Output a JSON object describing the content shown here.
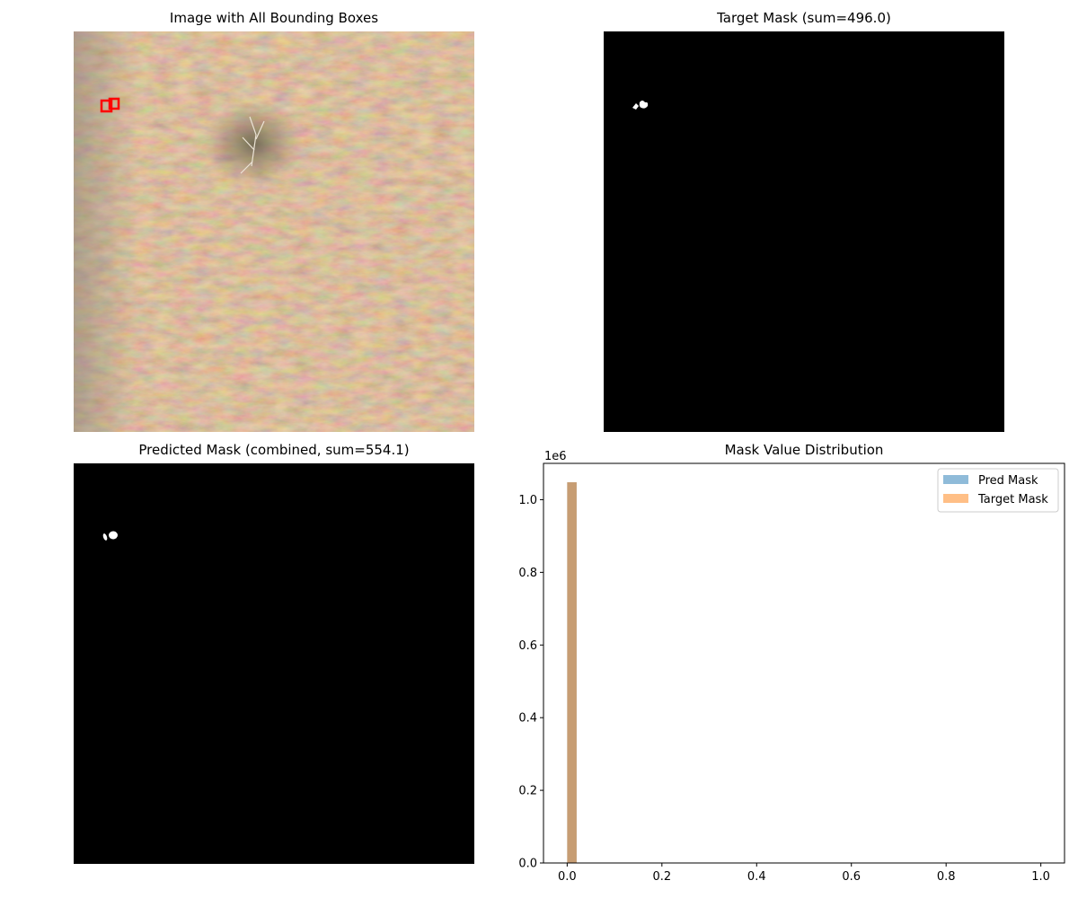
{
  "panels": {
    "image": {
      "title": "Image with All Bounding Boxes"
    },
    "target": {
      "title": "Target Mask (sum=496.0)"
    },
    "predicted": {
      "title": "Predicted Mask (combined, sum=554.1)"
    },
    "histogram": {
      "title": "Mask Value Distribution"
    }
  },
  "colors": {
    "ground": "#c9ab88",
    "bbox": "#ff0000",
    "mask_bg": "#000000",
    "mask_fg": "#ffffff",
    "pred_series": "#1f77b4",
    "target_series": "#ff7f0e",
    "overlap": "#c8a07c"
  },
  "chart_data": {
    "type": "bar",
    "title": "Mask Value Distribution",
    "xlim": [
      -0.05,
      1.05
    ],
    "ylim": [
      0,
      1100000
    ],
    "y_scale_label": "1e6",
    "xticks": [
      0.0,
      0.2,
      0.4,
      0.6,
      0.8,
      1.0
    ],
    "xtick_labels": [
      "0.0",
      "0.2",
      "0.4",
      "0.6",
      "0.8",
      "1.0"
    ],
    "yticks": [
      0,
      200000,
      400000,
      600000,
      800000,
      1000000
    ],
    "ytick_labels": [
      "0.0",
      "0.2",
      "0.4",
      "0.6",
      "0.8",
      "1.0"
    ],
    "bin_width": 0.02,
    "legend_position": "top-right",
    "series": [
      {
        "name": "Pred Mask",
        "bins": [
          {
            "x0": 0.0,
            "x1": 0.02,
            "count": 1048000
          }
        ]
      },
      {
        "name": "Target Mask",
        "bins": [
          {
            "x0": 0.0,
            "x1": 0.02,
            "count": 1048000
          }
        ]
      }
    ]
  }
}
